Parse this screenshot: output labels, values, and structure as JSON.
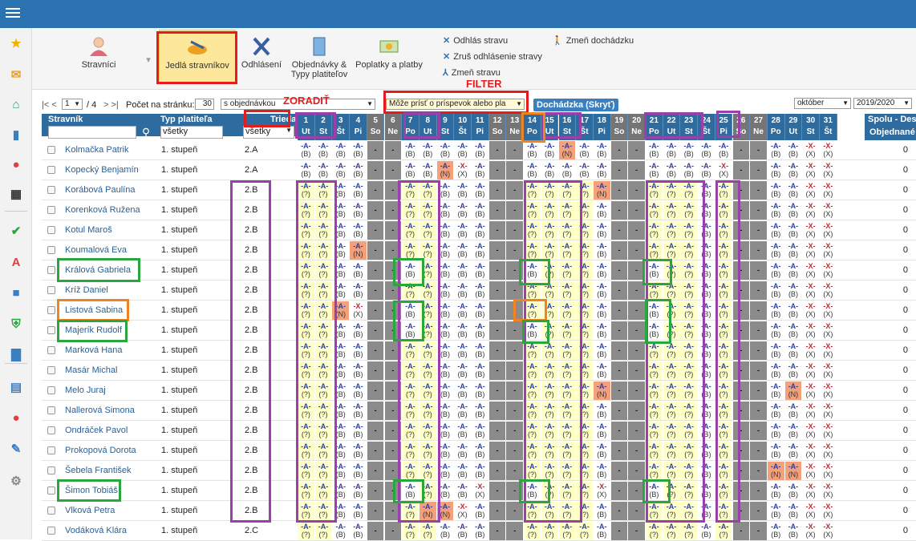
{
  "sidebar": {
    "icons": [
      "star-icon",
      "mail-icon",
      "home-icon",
      "book-icon",
      "person-icon",
      "calendar-icon",
      "check-icon",
      "a-plus-icon",
      "briefcase-icon",
      "shield-icon",
      "bar-chart-icon",
      "open-book-icon",
      "chat-icon",
      "pen-icon",
      "gear-icon"
    ]
  },
  "toolbar": {
    "stravnici": "Stravníci",
    "jedla": "Jedlá stravníkov",
    "odhlasenie": "Odhlásení",
    "objednavky": "Objednávky & Typy platiteľov",
    "poplatky": "Poplatky a platby",
    "links": [
      "Odhlás stravu",
      "Zruš odhlásenie stravy",
      "Zmeň stravu",
      "Zmeň dochádzku"
    ]
  },
  "controls": {
    "pager_prefix": "|< <",
    "page_value": "1",
    "page_total": "/ 4",
    "pager_suffix": "> >|",
    "per_page_label": "Počet na stránku:",
    "per_page_value": "30",
    "order_select": "s objednávkou",
    "filter_select": "Môže prísť o príspevok alebo pla",
    "attendance_button": "Dochádzka (Skryť)",
    "month_select": "október",
    "year_select": "2019/2020",
    "annotation_sort": "ZORADIŤ",
    "annotation_filter": "FILTER"
  },
  "headers": {
    "stravnik": "Stravník",
    "typ": "Typ platiteľa",
    "trieda": "Trieda",
    "typ_filter": "všetky",
    "trieda_filter": "všetky",
    "spolu": "Spolu - Desiata",
    "objednane": "Objednané",
    "extra": "S"
  },
  "days": [
    {
      "d": "1",
      "w": "Ut"
    },
    {
      "d": "2",
      "w": "St"
    },
    {
      "d": "3",
      "w": "Št"
    },
    {
      "d": "4",
      "w": "Pi"
    },
    {
      "d": "5",
      "w": "So"
    },
    {
      "d": "6",
      "w": "Ne"
    },
    {
      "d": "7",
      "w": "Po"
    },
    {
      "d": "8",
      "w": "Ut"
    },
    {
      "d": "9",
      "w": "St"
    },
    {
      "d": "10",
      "w": "Št"
    },
    {
      "d": "11",
      "w": "Pi"
    },
    {
      "d": "12",
      "w": "So"
    },
    {
      "d": "13",
      "w": "Ne"
    },
    {
      "d": "14",
      "w": "Po"
    },
    {
      "d": "15",
      "w": "Ut"
    },
    {
      "d": "16",
      "w": "St"
    },
    {
      "d": "17",
      "w": "Št"
    },
    {
      "d": "18",
      "w": "Pi"
    },
    {
      "d": "19",
      "w": "So"
    },
    {
      "d": "20",
      "w": "Ne"
    },
    {
      "d": "21",
      "w": "Po"
    },
    {
      "d": "22",
      "w": "Ut"
    },
    {
      "d": "23",
      "w": "St"
    },
    {
      "d": "24",
      "w": "Št"
    },
    {
      "d": "25",
      "w": "Pi"
    },
    {
      "d": "26",
      "w": "So"
    },
    {
      "d": "27",
      "w": "Ne"
    },
    {
      "d": "28",
      "w": "Po"
    },
    {
      "d": "29",
      "w": "Ut"
    },
    {
      "d": "30",
      "w": "St"
    },
    {
      "d": "31",
      "w": "Št"
    }
  ],
  "rows": [
    {
      "name": "Kolmačka Patrik",
      "typ": "1. stupeň",
      "trieda": "2.A",
      "sum": "0",
      "cells": [
        "B",
        "B",
        "B",
        "B",
        "-",
        "-",
        "B",
        "B",
        "B",
        "B",
        "B",
        "-",
        "-",
        "B",
        "B",
        "N",
        "B",
        "B",
        "-",
        "-",
        "B",
        "B",
        "B",
        "B",
        "B",
        "-",
        "-",
        "B",
        "B",
        "X",
        "X"
      ],
      "yellow": false
    },
    {
      "name": "Kopecký Benjamín",
      "typ": "1. stupeň",
      "trieda": "2.A",
      "sum": "0",
      "cells": [
        "B",
        "B",
        "B",
        "B",
        "-",
        "-",
        "B",
        "B",
        "N",
        "X",
        "B",
        "-",
        "-",
        "B",
        "B",
        "B",
        "B",
        "B",
        "-",
        "-",
        "B",
        "B",
        "B",
        "B",
        "X",
        "-",
        "-",
        "B",
        "B",
        "X",
        "X"
      ],
      "yellow": false
    },
    {
      "name": "Korábová Paulína",
      "typ": "1. stupeň",
      "trieda": "2.B",
      "sum": "0",
      "cells": [
        "?",
        "?",
        "B",
        "B",
        "-",
        "-",
        "?",
        "?",
        "B",
        "B",
        "B",
        "-",
        "-",
        "?",
        "?",
        "?",
        "?",
        "N",
        "-",
        "-",
        "?",
        "?",
        "?",
        "B",
        "?",
        "-",
        "-",
        "B",
        "B",
        "X",
        "X"
      ],
      "yellow": true
    },
    {
      "name": "Korenková Ružena",
      "typ": "1. stupeň",
      "trieda": "2.B",
      "sum": "0",
      "cells": [
        "?",
        "?",
        "B",
        "B",
        "-",
        "-",
        "?",
        "?",
        "B",
        "B",
        "B",
        "-",
        "-",
        "?",
        "?",
        "?",
        "?",
        "B",
        "-",
        "-",
        "?",
        "?",
        "?",
        "B",
        "?",
        "-",
        "-",
        "B",
        "B",
        "X",
        "X"
      ],
      "yellow": true
    },
    {
      "name": "Kotul Maroš",
      "typ": "1. stupeň",
      "trieda": "2.B",
      "sum": "0",
      "cells": [
        "?",
        "?",
        "B",
        "B",
        "-",
        "-",
        "?",
        "?",
        "B",
        "B",
        "B",
        "-",
        "-",
        "?",
        "?",
        "?",
        "?",
        "B",
        "-",
        "-",
        "?",
        "?",
        "?",
        "B",
        "?",
        "-",
        "-",
        "B",
        "B",
        "X",
        "X"
      ],
      "yellow": true
    },
    {
      "name": "Koumalová Eva",
      "typ": "1. stupeň",
      "trieda": "2.B",
      "sum": "0",
      "cells": [
        "?",
        "?",
        "B",
        "N",
        "-",
        "-",
        "?",
        "?",
        "B",
        "B",
        "B",
        "-",
        "-",
        "?",
        "?",
        "?",
        "?",
        "B",
        "-",
        "-",
        "?",
        "?",
        "?",
        "B",
        "?",
        "-",
        "-",
        "B",
        "B",
        "X",
        "X"
      ],
      "yellow": true
    },
    {
      "name": "Králová Gabriela",
      "typ": "1. stupeň",
      "trieda": "2.B",
      "sum": "0",
      "cells": [
        "?",
        "?",
        "B",
        "B",
        "-",
        "-",
        "B",
        "?",
        "B",
        "B",
        "B",
        "-",
        "-",
        "B",
        "?",
        "?",
        "?",
        "B",
        "-",
        "-",
        "B",
        "?",
        "?",
        "B",
        "?",
        "-",
        "-",
        "B",
        "B",
        "X",
        "X"
      ],
      "yellow": true
    },
    {
      "name": "Kríž Daniel",
      "typ": "1. stupeň",
      "trieda": "2.B",
      "sum": "0",
      "cells": [
        "?",
        "?",
        "B",
        "B",
        "-",
        "-",
        "?",
        "?",
        "B",
        "B",
        "B",
        "-",
        "-",
        "?",
        "?",
        "?",
        "?",
        "B",
        "-",
        "-",
        "?",
        "?",
        "?",
        "B",
        "?",
        "-",
        "-",
        "B",
        "B",
        "X",
        "X"
      ],
      "yellow": true
    },
    {
      "name": "Listová Sabina",
      "typ": "1. stupeň",
      "trieda": "2.B",
      "sum": "0",
      "cells": [
        "?",
        "?",
        "N",
        "X",
        "-",
        "-",
        "B",
        "?",
        "B",
        "B",
        "B",
        "-",
        "-",
        "?",
        "?",
        "?",
        "?",
        "B",
        "-",
        "-",
        "B",
        "?",
        "?",
        "B",
        "?",
        "-",
        "-",
        "B",
        "B",
        "X",
        "X"
      ],
      "yellow": true
    },
    {
      "name": "Majerík Rudolf",
      "typ": "1. stupeň",
      "trieda": "2.B",
      "sum": "0",
      "cells": [
        "?",
        "?",
        "B",
        "B",
        "-",
        "-",
        "B",
        "?",
        "B",
        "B",
        "B",
        "-",
        "-",
        "B",
        "?",
        "?",
        "?",
        "B",
        "-",
        "-",
        "B",
        "?",
        "?",
        "B",
        "?",
        "-",
        "-",
        "B",
        "B",
        "X",
        "X"
      ],
      "yellow": true
    },
    {
      "name": "Marková Hana",
      "typ": "1. stupeň",
      "trieda": "2.B",
      "sum": "0",
      "cells": [
        "?",
        "?",
        "B",
        "B",
        "-",
        "-",
        "?",
        "?",
        "B",
        "B",
        "B",
        "-",
        "-",
        "?",
        "?",
        "?",
        "?",
        "B",
        "-",
        "-",
        "?",
        "?",
        "?",
        "B",
        "?",
        "-",
        "-",
        "B",
        "B",
        "X",
        "X"
      ],
      "yellow": true
    },
    {
      "name": "Masár Michal",
      "typ": "1. stupeň",
      "trieda": "2.B",
      "sum": "0",
      "cells": [
        "?",
        "?",
        "B",
        "B",
        "-",
        "-",
        "?",
        "?",
        "B",
        "B",
        "B",
        "-",
        "-",
        "?",
        "?",
        "?",
        "?",
        "B",
        "-",
        "-",
        "?",
        "?",
        "?",
        "B",
        "?",
        "-",
        "-",
        "B",
        "B",
        "X",
        "X"
      ],
      "yellow": true
    },
    {
      "name": "Melo Juraj",
      "typ": "1. stupeň",
      "trieda": "2.B",
      "sum": "0",
      "cells": [
        "?",
        "?",
        "B",
        "B",
        "-",
        "-",
        "?",
        "?",
        "B",
        "B",
        "B",
        "-",
        "-",
        "?",
        "?",
        "?",
        "?",
        "N",
        "-",
        "-",
        "?",
        "?",
        "?",
        "B",
        "?",
        "-",
        "-",
        "B",
        "N",
        "X",
        "X"
      ],
      "yellow": true
    },
    {
      "name": "Nallerová Simona",
      "typ": "1. stupeň",
      "trieda": "2.B",
      "sum": "0",
      "cells": [
        "?",
        "?",
        "B",
        "B",
        "-",
        "-",
        "?",
        "?",
        "B",
        "B",
        "B",
        "-",
        "-",
        "?",
        "?",
        "?",
        "?",
        "B",
        "-",
        "-",
        "?",
        "?",
        "?",
        "B",
        "?",
        "-",
        "-",
        "B",
        "B",
        "X",
        "X"
      ],
      "yellow": true
    },
    {
      "name": "Ondráček Pavol",
      "typ": "1. stupeň",
      "trieda": "2.B",
      "sum": "0",
      "cells": [
        "?",
        "?",
        "B",
        "B",
        "-",
        "-",
        "?",
        "?",
        "B",
        "B",
        "B",
        "-",
        "-",
        "?",
        "?",
        "?",
        "?",
        "B",
        "-",
        "-",
        "?",
        "?",
        "?",
        "B",
        "?",
        "-",
        "-",
        "B",
        "B",
        "X",
        "X"
      ],
      "yellow": true
    },
    {
      "name": "Prokopová Dorota",
      "typ": "1. stupeň",
      "trieda": "2.B",
      "sum": "0",
      "cells": [
        "?",
        "?",
        "B",
        "B",
        "-",
        "-",
        "?",
        "?",
        "B",
        "B",
        "B",
        "-",
        "-",
        "?",
        "?",
        "?",
        "?",
        "B",
        "-",
        "-",
        "?",
        "?",
        "?",
        "B",
        "?",
        "-",
        "-",
        "B",
        "B",
        "X",
        "X"
      ],
      "yellow": true
    },
    {
      "name": "Šebela František",
      "typ": "1. stupeň",
      "trieda": "2.B",
      "sum": "0",
      "cells": [
        "?",
        "?",
        "B",
        "B",
        "-",
        "-",
        "?",
        "?",
        "B",
        "B",
        "B",
        "-",
        "-",
        "?",
        "?",
        "?",
        "?",
        "B",
        "-",
        "-",
        "?",
        "?",
        "?",
        "B",
        "?",
        "-",
        "-",
        "N",
        "N",
        "X",
        "X"
      ],
      "yellow": true
    },
    {
      "name": "Šimon Tobiáš",
      "typ": "1. stupeň",
      "trieda": "2.B",
      "sum": "0",
      "cells": [
        "?",
        "?",
        "B",
        "B",
        "-",
        "-",
        "B",
        "?",
        "B",
        "B",
        "X",
        "-",
        "-",
        "B",
        "?",
        "?",
        "?",
        "X",
        "-",
        "-",
        "B",
        "?",
        "?",
        "B",
        "?",
        "-",
        "-",
        "B",
        "B",
        "X",
        "X"
      ],
      "yellow": true
    },
    {
      "name": "Vlková Petra",
      "typ": "1. stupeň",
      "trieda": "2.B",
      "sum": "0",
      "cells": [
        "?",
        "?",
        "B",
        "B",
        "-",
        "-",
        "?",
        "N",
        "N",
        "X",
        "B",
        "-",
        "-",
        "?",
        "?",
        "?",
        "?",
        "B",
        "-",
        "-",
        "?",
        "?",
        "?",
        "B",
        "?",
        "-",
        "-",
        "B",
        "B",
        "X",
        "X"
      ],
      "yellow": true
    },
    {
      "name": "Vodáková Klára",
      "typ": "1. stupeň",
      "trieda": "2.C",
      "sum": "0",
      "cells": [
        "?",
        "?",
        "B",
        "B",
        "-",
        "-",
        "?",
        "?",
        "B",
        "B",
        "B",
        "-",
        "-",
        "?",
        "?",
        "?",
        "?",
        "B",
        "-",
        "-",
        "?",
        "?",
        "?",
        "B",
        "?",
        "-",
        "-",
        "B",
        "B",
        "X",
        "X"
      ],
      "yellow": true
    }
  ]
}
